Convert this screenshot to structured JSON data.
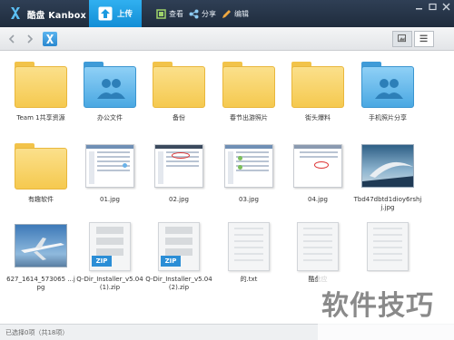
{
  "titlebar": {
    "app_title": "酷盘 Kanbox",
    "upload_label": "上传",
    "tools": [
      {
        "label": "查看",
        "icon": "view-icon"
      },
      {
        "label": "分享",
        "icon": "share-icon"
      },
      {
        "label": "编辑",
        "icon": "edit-icon"
      }
    ],
    "window_buttons": [
      "minimize-icon",
      "maximize-icon",
      "close-icon"
    ]
  },
  "navbar": {
    "back_icon": "back-arrow-icon",
    "forward_icon": "forward-arrow-icon",
    "home_icon": "kanbox-home-icon",
    "view_modes": [
      "thumbnail-view-icon",
      "list-view-icon"
    ]
  },
  "files": [
    {
      "name": "Team 1共享资源",
      "kind": "folder",
      "color": "yellow"
    },
    {
      "name": "办公文件",
      "kind": "folder-shared",
      "color": "blue"
    },
    {
      "name": "备份",
      "kind": "folder",
      "color": "yellow"
    },
    {
      "name": "春节出游照片",
      "kind": "folder",
      "color": "yellow"
    },
    {
      "name": "街头爆料",
      "kind": "folder",
      "color": "yellow"
    },
    {
      "name": "手机照片分享",
      "kind": "folder-shared",
      "color": "blue"
    },
    {
      "name": "有趣软件",
      "kind": "folder",
      "color": "yellow"
    },
    {
      "name": "01.jpg",
      "kind": "screenshot"
    },
    {
      "name": "02.jpg",
      "kind": "screenshot"
    },
    {
      "name": "03.jpg",
      "kind": "screenshot"
    },
    {
      "name": "04.jpg",
      "kind": "screenshot"
    },
    {
      "name": "Tbd47dbtd1dioy6rshjj.jpg",
      "kind": "photo-sky"
    },
    {
      "name": "627_1614_573065 ...jpg",
      "kind": "photo-plane"
    },
    {
      "name": "Q-Dir_Installer_v5.04(1).zip",
      "kind": "zip",
      "tag": "ZIP"
    },
    {
      "name": "Q-Dir_Installer_v5.04(2).zip",
      "kind": "zip",
      "tag": "ZIP"
    },
    {
      "name": "的.txt",
      "kind": "text"
    },
    {
      "name": "酷盘应",
      "kind": "text"
    },
    {
      "name": "",
      "kind": "text"
    }
  ],
  "status": {
    "text": "已选择0项（共18项）"
  },
  "watermark": {
    "text": "软件技巧"
  },
  "colors": {
    "titlebar": "#24334a",
    "accent": "#1a9ae0",
    "folder_yellow": "#f5c94f",
    "folder_blue": "#4aa8e2"
  }
}
